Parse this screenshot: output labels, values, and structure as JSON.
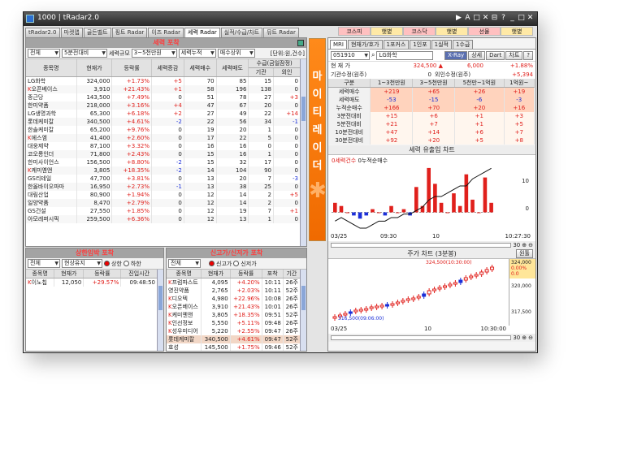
{
  "window": {
    "title": "1000 | tRadar2.0",
    "controls": [
      "▶",
      "A",
      "□",
      "✕",
      "⊟",
      "?",
      "_",
      "□",
      "✕"
    ]
  },
  "tabs": [
    "tRadar2.0",
    "마켓맵",
    "골든벨트",
    "핑트 Radar",
    "이즈 Radar",
    "세력 Radar",
    "실적/수급/차트",
    "뮤트 Radar"
  ],
  "active_tab": 5,
  "index_bar": [
    {
      "label": "코스피",
      "bg": "#ffc0c0"
    },
    {
      "label": "햇볕",
      "bg": "#ffe9a6"
    },
    {
      "label": "코스닥",
      "bg": "#ffc0c0"
    },
    {
      "label": "햇볕",
      "bg": "#ffe9a6"
    },
    {
      "label": "선물",
      "bg": "#ffc0c0"
    },
    {
      "label": "햇볕",
      "bg": "#ffe9a6"
    }
  ],
  "force_panel": {
    "title": "세력 포착",
    "controls": [
      "전체",
      "5분전대비",
      "세력규모",
      "3~5천만원",
      "세력누적",
      "매수상위"
    ],
    "unit": "[단위:원,건수]",
    "columns": [
      "종목명",
      "현재가",
      "등락률",
      "세력증감",
      "세력매수",
      "세력매도",
      "기관",
      "외인"
    ],
    "supply_header": "수급(금일잠정)",
    "rows": [
      {
        "name": "LG화학",
        "price": "324,000",
        "rate": "+1.73%",
        "chg": "+5",
        "buy": "70",
        "sell": "85",
        "inst": "15",
        "fore": "0",
        "k": false
      },
      {
        "name": "오픈베이스",
        "price": "3,910",
        "rate": "+21.43%",
        "chg": "+1",
        "buy": "58",
        "sell": "196",
        "inst": "138",
        "fore": "0",
        "k": true
      },
      {
        "name": "종근당",
        "price": "143,500",
        "rate": "+7.49%",
        "chg": "0",
        "buy": "51",
        "sell": "78",
        "inst": "27",
        "fore": "+3",
        "k": false
      },
      {
        "name": "한미약품",
        "price": "218,000",
        "rate": "+3.16%",
        "chg": "+4",
        "buy": "47",
        "sell": "67",
        "inst": "20",
        "fore": "0",
        "k": false
      },
      {
        "name": "LG생명과학",
        "price": "65,300",
        "rate": "+6.18%",
        "chg": "+2",
        "buy": "27",
        "sell": "49",
        "inst": "22",
        "fore": "+14",
        "k": false
      },
      {
        "name": "롯데케미칼",
        "price": "340,500",
        "rate": "+4.61%",
        "chg": "-2",
        "buy": "22",
        "sell": "56",
        "inst": "34",
        "fore": "-1",
        "k": false
      },
      {
        "name": "한솔케미칼",
        "price": "65,200",
        "rate": "+9.76%",
        "chg": "0",
        "buy": "19",
        "sell": "20",
        "inst": "1",
        "fore": "0",
        "k": false
      },
      {
        "name": "에스엠",
        "price": "41,400",
        "rate": "+2.60%",
        "chg": "0",
        "buy": "17",
        "sell": "22",
        "inst": "5",
        "fore": "0",
        "k": true
      },
      {
        "name": "대웅제약",
        "price": "87,100",
        "rate": "+3.32%",
        "chg": "0",
        "buy": "16",
        "sell": "16",
        "inst": "0",
        "fore": "0",
        "k": false
      },
      {
        "name": "코오롱인더",
        "price": "71,800",
        "rate": "+2.43%",
        "chg": "0",
        "buy": "15",
        "sell": "16",
        "inst": "1",
        "fore": "0",
        "k": false
      },
      {
        "name": "한미사이언스",
        "price": "156,500",
        "rate": "+8.80%",
        "chg": "-2",
        "buy": "15",
        "sell": "32",
        "inst": "17",
        "fore": "0",
        "k": false
      },
      {
        "name": "케미옌앤",
        "price": "3,805",
        "rate": "+18.35%",
        "chg": "-2",
        "buy": "14",
        "sell": "104",
        "inst": "90",
        "fore": "0",
        "k": true
      },
      {
        "name": "GS리테일",
        "price": "47,700",
        "rate": "+3.81%",
        "chg": "0",
        "buy": "13",
        "sell": "20",
        "inst": "7",
        "fore": "-3",
        "k": false
      },
      {
        "name": "한올바이오파마",
        "price": "16,950",
        "rate": "+2.73%",
        "chg": "-1",
        "buy": "13",
        "sell": "38",
        "inst": "25",
        "fore": "0",
        "k": false
      },
      {
        "name": "대림산업",
        "price": "80,900",
        "rate": "+1.94%",
        "chg": "0",
        "buy": "12",
        "sell": "14",
        "inst": "2",
        "fore": "+5",
        "k": false
      },
      {
        "name": "일양약품",
        "price": "8,470",
        "rate": "+2.79%",
        "chg": "0",
        "buy": "12",
        "sell": "14",
        "inst": "2",
        "fore": "0",
        "k": false
      },
      {
        "name": "GS건설",
        "price": "27,550",
        "rate": "+1.85%",
        "chg": "0",
        "buy": "12",
        "sell": "19",
        "inst": "7",
        "fore": "+1",
        "k": false
      },
      {
        "name": "아모레퍼시픽",
        "price": "259,500",
        "rate": "+6.36%",
        "chg": "0",
        "buy": "12",
        "sell": "13",
        "inst": "1",
        "fore": "0",
        "k": false
      }
    ]
  },
  "upper_panel": {
    "title": "상한임박 포착",
    "controls": [
      "전체",
      "현상유지"
    ],
    "radios": [
      "상한",
      "하한"
    ],
    "columns": [
      "종목명",
      "현재가",
      "등락률",
      "진입시간"
    ],
    "rows": [
      {
        "name": "이노칩",
        "price": "12,050",
        "rate": "+29.57%",
        "time": "09:48:50",
        "k": true
      }
    ]
  },
  "high_panel": {
    "title": "신고가/신저가 포착",
    "controls": [
      "전체"
    ],
    "radios": [
      "신고가",
      "신저가"
    ],
    "columns": [
      "종목명",
      "현재가",
      "등락률",
      "포착",
      "기간"
    ],
    "rows": [
      {
        "name": "프럼파스트",
        "price": "4,095",
        "rate": "+4.20%",
        "time": "10:11",
        "period": "26주",
        "k": true
      },
      {
        "name": "영진약품",
        "price": "2,765",
        "rate": "+2.03%",
        "time": "10:11",
        "period": "52주",
        "k": false
      },
      {
        "name": "디오텍",
        "price": "4,980",
        "rate": "+22.96%",
        "time": "10:08",
        "period": "26주",
        "k": true
      },
      {
        "name": "오픈베이스",
        "price": "3,910",
        "rate": "+21.43%",
        "time": "10:01",
        "period": "26주",
        "k": true
      },
      {
        "name": "케미옌앤",
        "price": "3,805",
        "rate": "+18.35%",
        "time": "09:51",
        "period": "52주",
        "k": true
      },
      {
        "name": "인선정보",
        "price": "5,550",
        "rate": "+5.11%",
        "time": "09:48",
        "period": "26주",
        "k": true
      },
      {
        "name": "성우미디어",
        "price": "5,220",
        "rate": "+2.55%",
        "time": "09:47",
        "period": "26주",
        "k": true
      },
      {
        "name": "롯데케미칼",
        "price": "340,500",
        "rate": "+4.61%",
        "time": "09:47",
        "period": "52주",
        "k": false
      },
      {
        "name": "효성",
        "price": "145,500",
        "rate": "+1.75%",
        "time": "09:46",
        "period": "52주",
        "k": false
      }
    ]
  },
  "mighty": {
    "label": "마이티레이더"
  },
  "right_panel": {
    "tabs": [
      "MRI",
      "현재가/호가",
      "1포커스",
      "1인포",
      "1실적",
      "1수급"
    ],
    "code": "051910",
    "name": "LG화학",
    "buttons": [
      "X-Ray",
      "상세",
      "Dart",
      "차트",
      "?"
    ],
    "price_label": "현 재 가",
    "price": "324,500 ▲",
    "change": "6,000",
    "rate": "+1.88%",
    "inst_label": "기관수정(원주)",
    "inst_value": "0",
    "fore_label": "외인수정(원주)",
    "fore_value": "+5,394",
    "grid_cols": [
      "구분",
      "1~3천만원",
      "3~5천만원",
      "5천만~1억원",
      "1억원~"
    ],
    "grid_rows": [
      {
        "label": "세력매수",
        "v": [
          "+219",
          "+65",
          "+26",
          "+19"
        ]
      },
      {
        "label": "세력매도",
        "v": [
          "-53",
          "-15",
          "-6",
          "-3"
        ]
      },
      {
        "label": "누적순매수",
        "v": [
          "+166",
          "+70",
          "+20",
          "+16"
        ]
      },
      {
        "label": "3분전대비",
        "v": [
          "+15",
          "+6",
          "+1",
          "+3"
        ]
      },
      {
        "label": "5분전대비",
        "v": [
          "+21",
          "+7",
          "+1",
          "+5"
        ]
      },
      {
        "label": "10분전대비",
        "v": [
          "+47",
          "+14",
          "+6",
          "+7"
        ]
      },
      {
        "label": "30분전대비",
        "v": [
          "+92",
          "+20",
          "+5",
          "+8"
        ]
      }
    ]
  },
  "force_chart": {
    "title": "세력 유출입 차트",
    "legend": "0세력건수",
    "legend2": "0누적순매수",
    "x_labels": [
      "03/25",
      "09:30",
      "10",
      "10:27:30"
    ],
    "y_labels": [
      "10",
      "0"
    ],
    "zoom": "30"
  },
  "chart_data": {
    "type": "bar",
    "title": "세력 유출입 차트",
    "xlabel": "",
    "ylabel": "",
    "ylim": [
      -5,
      15
    ],
    "values": [
      3,
      2,
      0,
      -1,
      -2,
      -1,
      1,
      0,
      -1,
      2,
      0,
      1,
      -1,
      8,
      2,
      14,
      9,
      3,
      0,
      6,
      2,
      12,
      4,
      0,
      11,
      3
    ],
    "cumulative": [
      1,
      2,
      1,
      0,
      -1,
      -1,
      0,
      1,
      1,
      2,
      2,
      3,
      3,
      4,
      5,
      7,
      8,
      8,
      9,
      10,
      11,
      11,
      13,
      14,
      15,
      16
    ]
  },
  "price_chart": {
    "title": "주가 차트 (3분봉)",
    "button": "원툴",
    "high_label": "324,500(10:30:00)",
    "low_label": "316,500(09:06:00)",
    "right_values": [
      "324,000",
      "0.00%",
      "0.0",
      "320,000",
      "317,500"
    ],
    "x_labels": [
      "03/25",
      "10",
      "10:30:00"
    ],
    "zoom": "30"
  }
}
